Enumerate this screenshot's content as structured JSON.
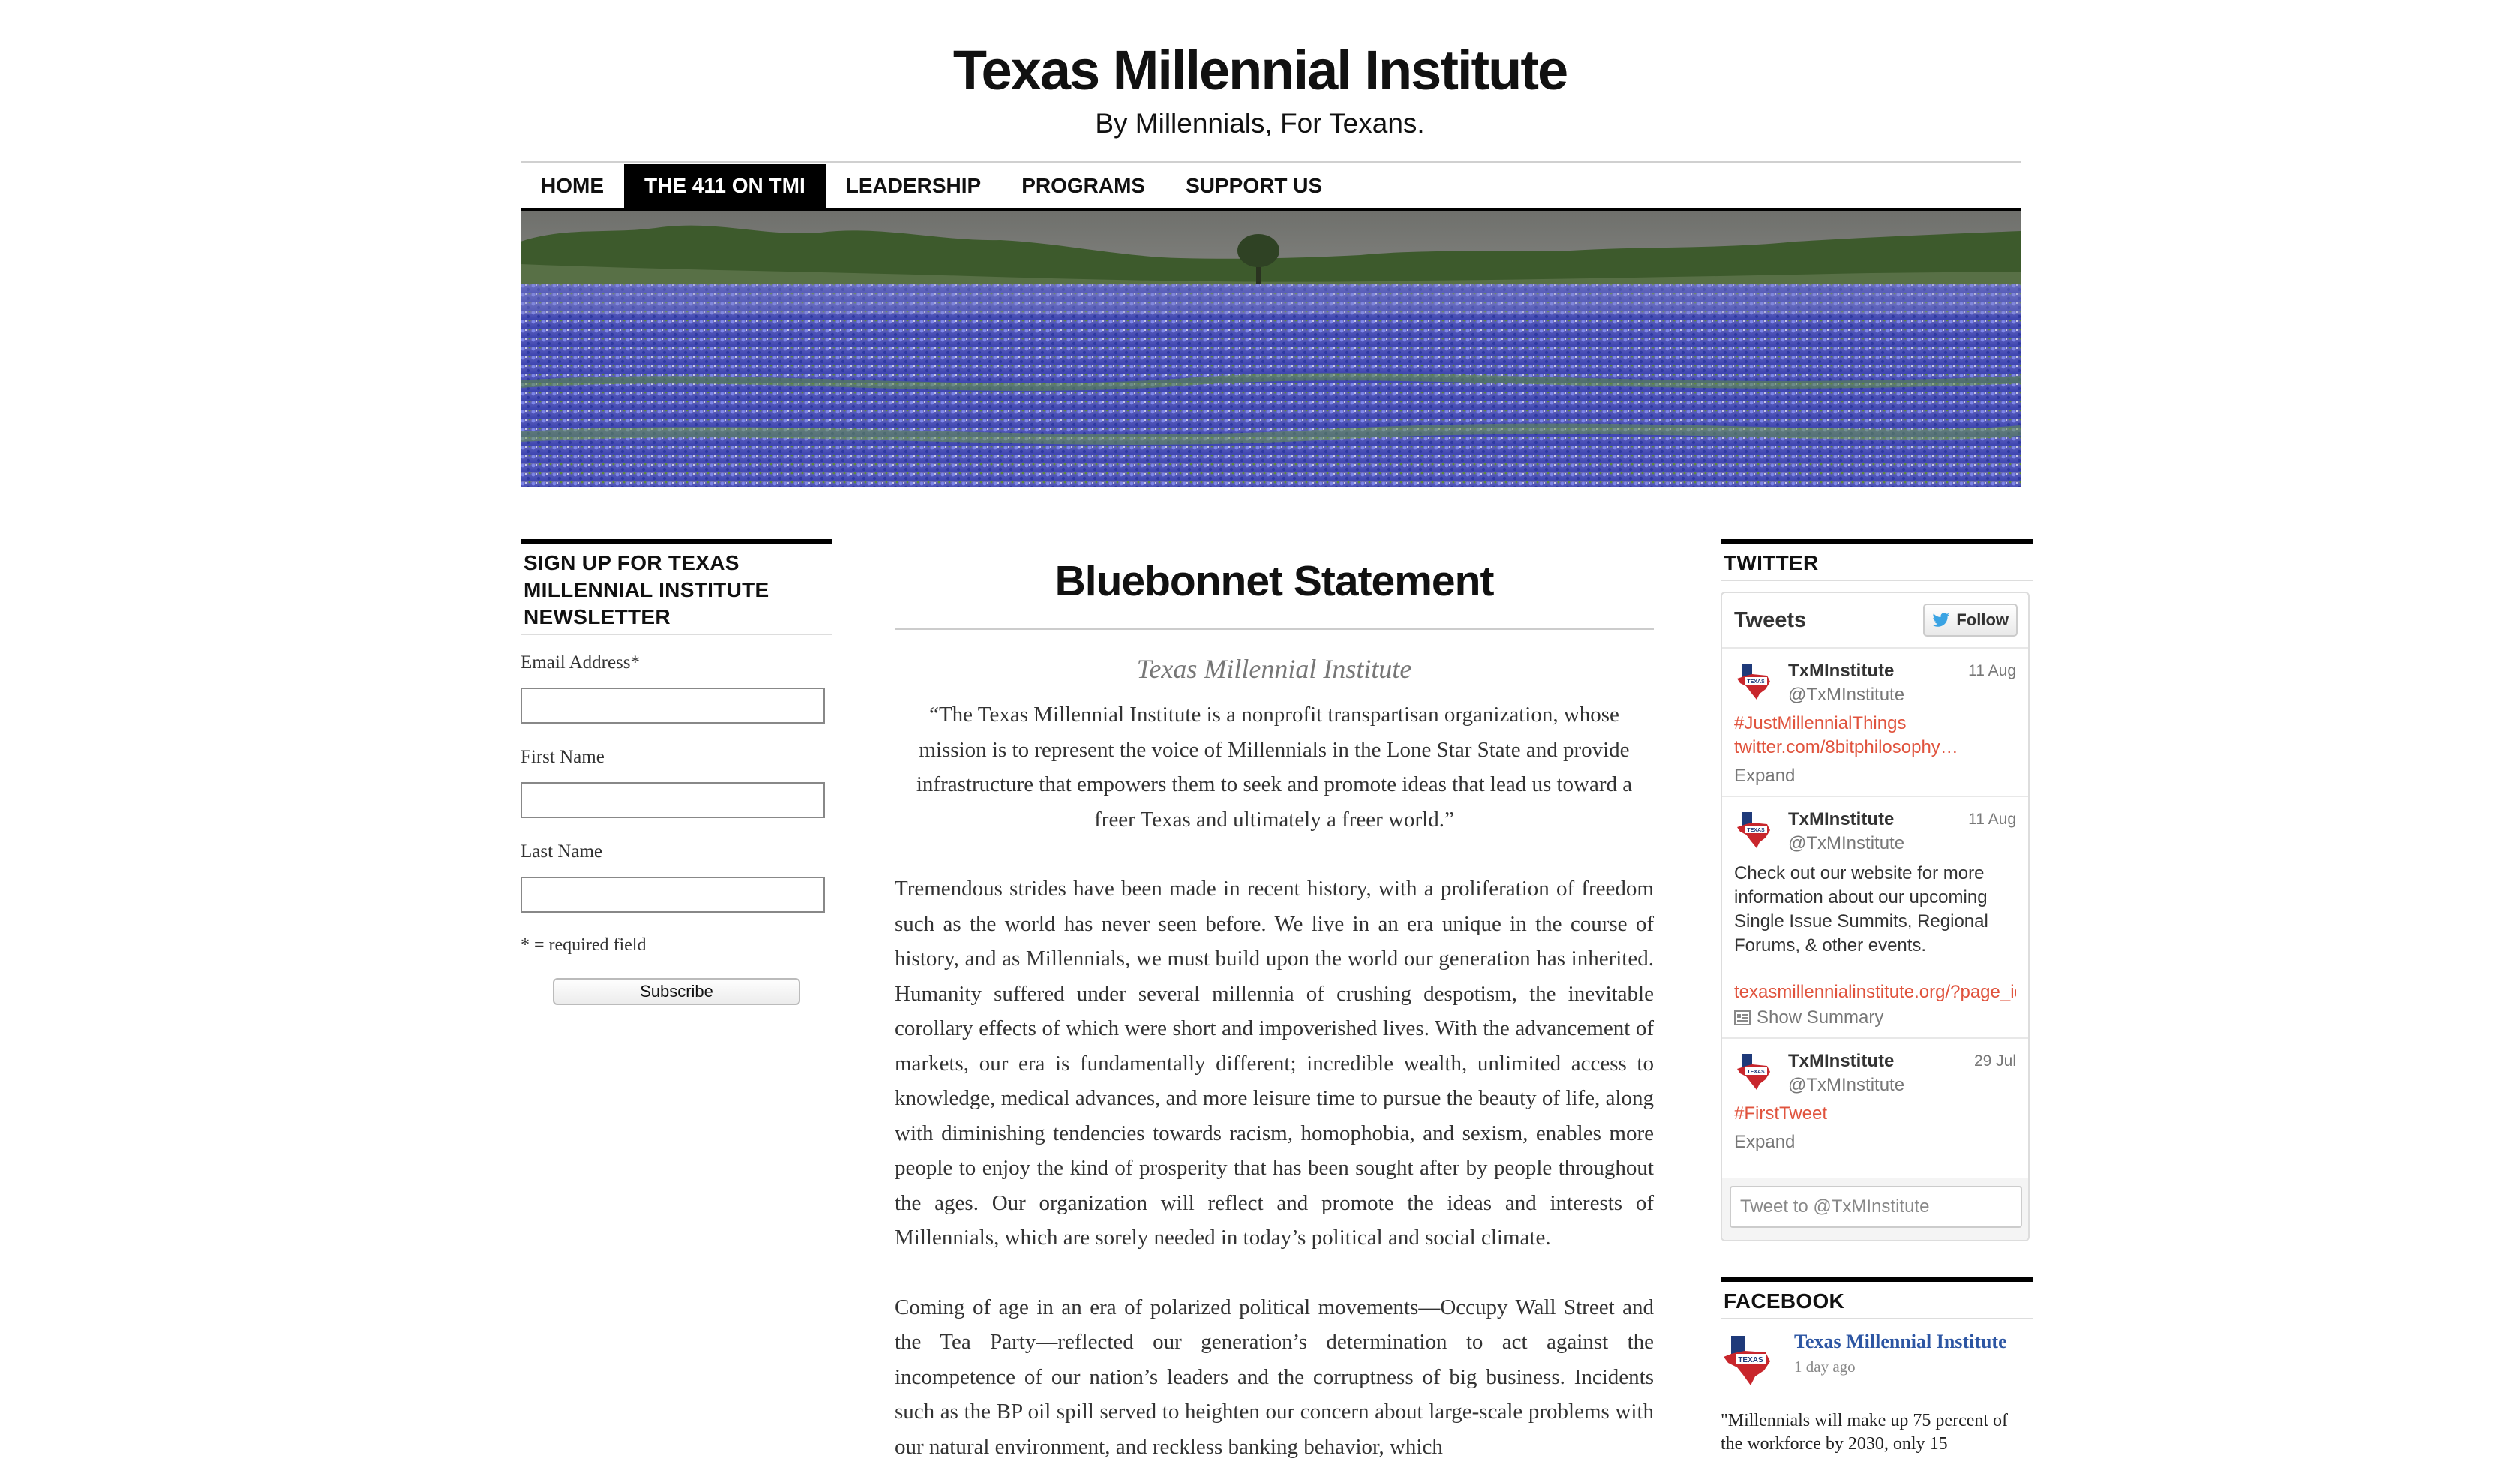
{
  "header": {
    "title": "Texas Millennial Institute",
    "tagline": "By Millennials, For Texans."
  },
  "nav": {
    "items": [
      "Home",
      "The 411 on TMI",
      "Leadership",
      "Programs",
      "Support Us"
    ],
    "active_index": 1
  },
  "newsletter": {
    "title": "Sign up for Texas Millennial Institute Newsletter",
    "email_label": "Email Address*",
    "first_name_label": "First Name",
    "last_name_label": "Last Name",
    "required_note": "* = required field",
    "subscribe_label": "Subscribe"
  },
  "post": {
    "title": "Bluebonnet Statement",
    "byline": "Texas Millennial Institute",
    "quote": "“The Texas Millennial Institute is a nonprofit transpartisan organization, whose mission is to represent the voice of Millennials in the Lone Star State and provide infrastructure that empowers them to seek and promote ideas that lead us toward a freer Texas and ultimately a freer world.”",
    "paragraphs": [
      "Tremendous strides have been made in recent history, with a proliferation of freedom such as the world has never seen before.  We live in an era unique in the course of history, and as Millennials, we must build upon the world our generation has inherited.  Humanity suffered under several millennia of crushing despotism, the inevitable corollary effects of which were short and impoverished lives. With the advancement of markets, our era is fundamentally different; incredible wealth, unlimited access to knowledge, medical advances, and more leisure time to pursue the beauty of life, along with diminishing tendencies towards racism, homophobia, and sexism, enables more people to enjoy the kind of prosperity that has been sought after by people throughout the ages. Our organization will reflect and promote the ideas and interests of Millennials, which are sorely needed in today’s political and social climate.",
      "Coming of age in an era of polarized political movements—Occupy Wall Street and the Tea Party—reflected our generation’s determination to act against the incompetence of our nation’s leaders and the corruptness of big business. Incidents such as the BP oil spill served to heighten our concern about large-scale problems with our natural environment, and reckless banking behavior, which"
    ]
  },
  "twitter": {
    "section_title": "Twitter",
    "box_title": "Tweets",
    "follow_label": "Follow",
    "tweets": [
      {
        "name": "TxMInstitute",
        "handle": "@TxMInstitute",
        "date": "11 Aug",
        "text": "",
        "links": [
          "#JustMillennialThings",
          " twitter.com/8bitphilosophy…"
        ],
        "action": "Expand"
      },
      {
        "name": "TxMInstitute",
        "handle": "@TxMInstitute",
        "date": "11 Aug",
        "text": "Check out our website for more information about our upcoming Single Issue Summits, Regional Forums, & other events.",
        "links": [
          "texasmillennialinstitute.org/?page_id"
        ],
        "action": "Show Summary"
      },
      {
        "name": "TxMInstitute",
        "handle": "@TxMInstitute",
        "date": "29 Jul",
        "text": "",
        "links": [
          "#FirstTweet"
        ],
        "action": "Expand"
      }
    ],
    "compose_placeholder": "Tweet to @TxMInstitute"
  },
  "facebook": {
    "section_title": "Facebook",
    "page_name": "Texas Millennial Institute",
    "time": "1 day ago",
    "text": "\"Millennials will make up 75 percent of the workforce by 2030, only 15"
  },
  "colors": {
    "link": "#e0533d",
    "facebook_link": "#2d56a3",
    "nav_active_bg": "#000000",
    "bluebonnet": "#4b56c4"
  }
}
